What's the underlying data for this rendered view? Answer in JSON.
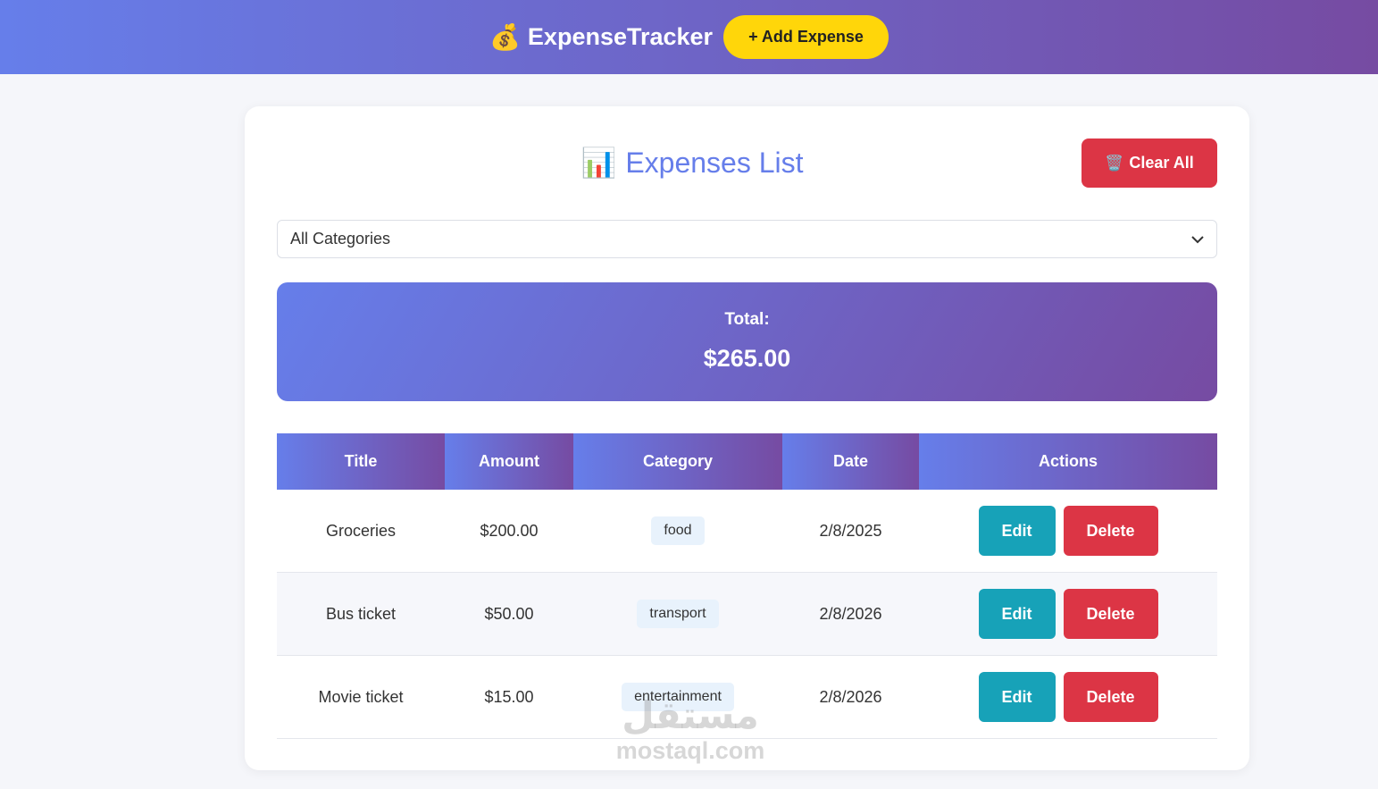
{
  "navbar": {
    "brand_icon": "💰",
    "brand": "ExpenseTracker",
    "add_button": "+ Add Expense"
  },
  "list": {
    "title_icon": "📊",
    "title": "Expenses List",
    "clear_icon": "🗑️",
    "clear_button": "Clear All"
  },
  "filter": {
    "selected": "All Categories",
    "chevron": "⌄"
  },
  "total": {
    "label": "Total:",
    "value": "$265.00"
  },
  "table": {
    "headers": [
      "Title",
      "Amount",
      "Category",
      "Date",
      "Actions"
    ],
    "rows": [
      {
        "title": "Groceries",
        "amount": "$200.00",
        "category": "food",
        "date": "2/8/2025"
      },
      {
        "title": "Bus ticket",
        "amount": "$50.00",
        "category": "transport",
        "date": "2/8/2026"
      },
      {
        "title": "Movie ticket",
        "amount": "$15.00",
        "category": "entertainment",
        "date": "2/8/2026"
      }
    ],
    "edit_label": "Edit",
    "delete_label": "Delete"
  },
  "watermark": {
    "arabic": "مستقل",
    "latin": "mostaql.com"
  },
  "colors": {
    "accent": "#667eea",
    "accent_end": "#764ba2",
    "danger": "#dc3545",
    "edit": "#17a2b8",
    "highlight": "#ffd60a"
  }
}
